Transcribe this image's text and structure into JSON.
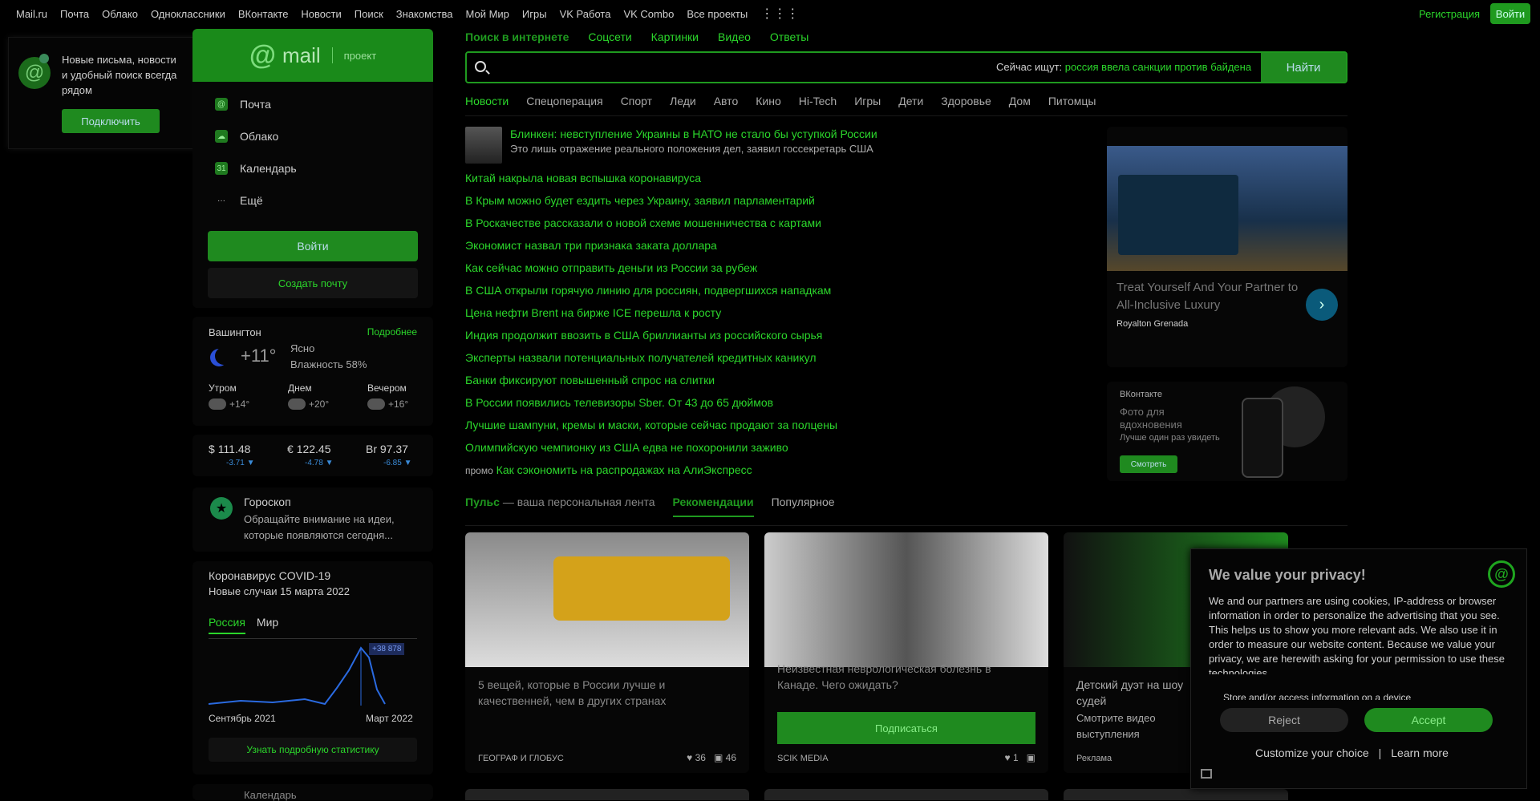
{
  "topbar": {
    "links": [
      "Mail.ru",
      "Почта",
      "Облако",
      "Одноклассники",
      "ВКонтакте",
      "Новости",
      "Поиск",
      "Знакомства",
      "Мой Мир",
      "Игры",
      "VK Работа",
      "VK Combo",
      "Все проекты"
    ],
    "register": "Регистрация",
    "login": "Войти"
  },
  "notify": {
    "text": "Новые письма, новости и удобный поиск всегда рядом",
    "button": "Подключить",
    "age": "0+"
  },
  "mailbox": {
    "brand": "mail",
    "project": "проект",
    "items": [
      "Почта",
      "Облако",
      "Календарь",
      "Ещё"
    ],
    "enter": "Войти",
    "create": "Создать почту"
  },
  "weather": {
    "city": "Вашингтон",
    "more": "Подробнее",
    "temp": "+11°",
    "cond": "Ясно",
    "humidity": "Влажность 58%",
    "parts": [
      {
        "name": "Утром",
        "temp": "+14°"
      },
      {
        "name": "Днем",
        "temp": "+20°"
      },
      {
        "name": "Вечером",
        "temp": "+16°"
      }
    ]
  },
  "currency": [
    {
      "sym": "$",
      "val": "111.48",
      "delta": "-3.71 ▼"
    },
    {
      "sym": "€",
      "val": "122.45",
      "delta": "-4.78 ▼"
    },
    {
      "sym": "Br",
      "val": "97.37",
      "delta": "-6.85 ▼"
    }
  ],
  "horoscope": {
    "title": "Гороскоп",
    "text": "Обращайте внимание на идеи, которые появляются сегодня..."
  },
  "covid": {
    "title": "Коронавирус COVID-19",
    "sub": "Новые случаи 15 марта 2022",
    "tabs": [
      "Россия",
      "Мир"
    ],
    "value": "+38 878",
    "from": "Сентябрь 2021",
    "to": "Март 2022",
    "stats": "Узнать подробную статистику"
  },
  "nextcard": {
    "title": "Календарь"
  },
  "search": {
    "tabs": [
      "Поиск в интернете",
      "Соцсети",
      "Картинки",
      "Видео",
      "Ответы"
    ],
    "hint": "Сейчас ищут:",
    "hint_link": "россия ввела санкции против байдена",
    "button": "Найти"
  },
  "newstabs": [
    "Новости",
    "Спецоперация",
    "Спорт",
    "Леди",
    "Авто",
    "Кино",
    "Hi-Tech",
    "Игры",
    "Дети",
    "Здоровье",
    "Дом",
    "Питомцы"
  ],
  "news": {
    "lead_title": "Блинкен: невступление Украины в НАТО не стало бы уступкой России",
    "lead_sub": "Это лишь отражение реального положения дел, заявил госсекретарь США",
    "items": [
      "Китай накрыла новая вспышка коронавируса",
      "В Крым можно будет ездить через Украину, заявил парламентарий",
      "В Роскачестве рассказали о новой схеме мошенничества с картами",
      "Экономист назвал три признака заката доллара",
      "Как сейчас можно отправить деньги из России за рубеж",
      "В США открыли горячую линию для россиян, подвергшихся нападкам",
      "Цена нефти Brent на бирже ICE перешла к росту",
      "Индия продолжит ввозить в США бриллианты из российского сырья",
      "Эксперты назвали потенциальных получателей кредитных каникул",
      "Банки фиксируют повышенный спрос на слитки",
      "В России появились телевизоры Sber. От 43 до 65 дюймов",
      "Лучшие шампуни, кремы и маски, которые сейчас продают за полцены",
      "Олимпийскую чемпионку из США едва не похоронили заживо",
      "Как сэкономить на распродажах на АлиЭкспресс"
    ],
    "promo_tag": "промо"
  },
  "ad1": {
    "title": "Treat Yourself And Your Partner to All-Inclusive Luxury",
    "source": "Royalton Grenada"
  },
  "ad2": {
    "vk": "ВКонтакте",
    "title": "Фото для вдохновения",
    "sub": "Лучше один раз увидеть",
    "button": "Смотреть"
  },
  "feedtabs": {
    "pulse": "Пульс",
    "pulse_sub": "— ваша персональная лента",
    "rec": "Рекомендации",
    "pop": "Популярное"
  },
  "feed": [
    {
      "title": "5 вещей, которые в России лучше и качественней, чем в других странах",
      "src": "ГЕОГРАФ И ГЛОБУС",
      "likes": "36",
      "comments": "46"
    },
    {
      "title": "Неизвестная неврологическая болезнь в Канаде. Чего ожидать?",
      "src": "SCIK MEDIA",
      "sub": "Подписаться",
      "likes": "1"
    },
    {
      "title": "Детский дуэт на шоу",
      "title2": "судей",
      "extra": "Смотрите видео выступления",
      "src": "Реклама"
    }
  ],
  "privacy": {
    "title": "We value your privacy!",
    "body": "We and our partners are using cookies, IP-address or browser information in order to personalize the advertising that you see. This helps us to show you more relevant ads. We also use it in order to measure our website content. Because we value your privacy, we are herewith asking for your permission to use these technologies.",
    "body2": "Store and/or access information on a device",
    "reject": "Reject",
    "accept": "Accept",
    "custom": "Customize your choice",
    "sep": "|",
    "learn": "Learn more"
  }
}
